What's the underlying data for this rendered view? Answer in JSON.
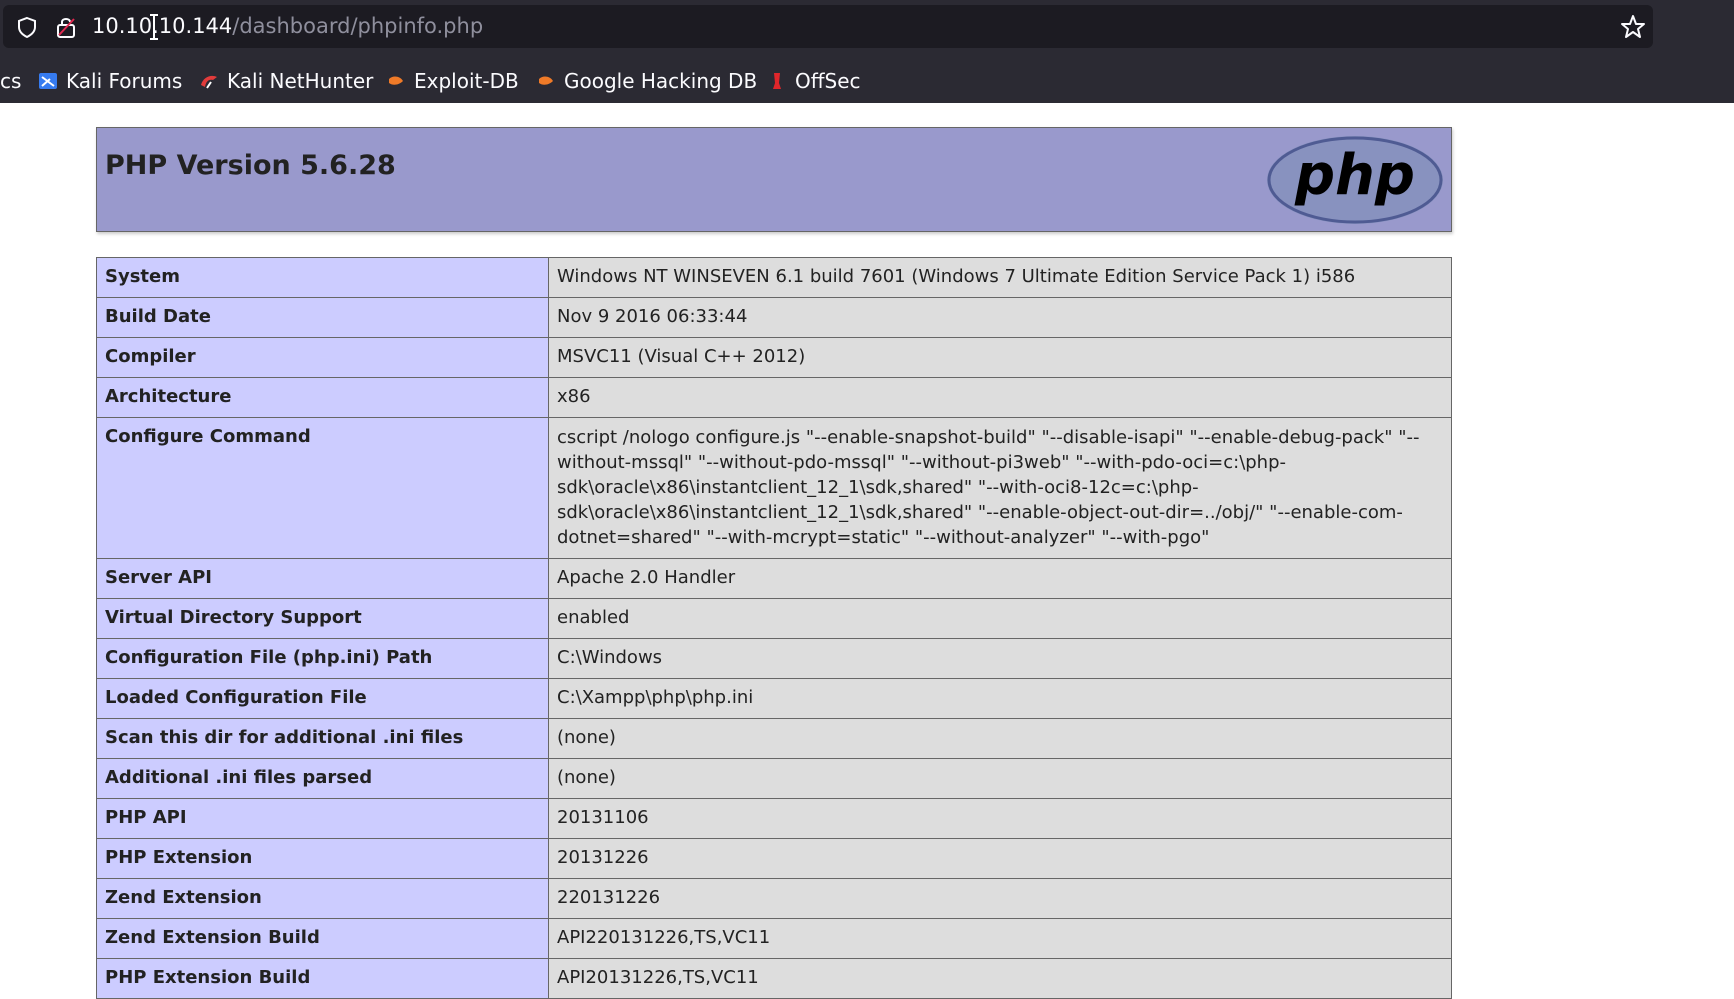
{
  "browser": {
    "url_host": "10.10.10.144",
    "url_path": "/dashboard/phpinfo.php",
    "bookmarks": [
      {
        "label": "cs",
        "icon": "folder-icon"
      },
      {
        "label": "Kali Forums",
        "icon": "kali-forums-icon"
      },
      {
        "label": "Kali NetHunter",
        "icon": "kali-nethunter-icon"
      },
      {
        "label": "Exploit-DB",
        "icon": "exploit-db-icon"
      },
      {
        "label": "Google Hacking DB",
        "icon": "google-hacking-db-icon"
      },
      {
        "label": "OffSec",
        "icon": "offsec-icon"
      }
    ]
  },
  "page": {
    "title": "PHP Version 5.6.28",
    "logo_text": "php",
    "rows": [
      {
        "key": "System",
        "value": "Windows NT WINSEVEN 6.1 build 7601 (Windows 7 Ultimate Edition Service Pack 1) i586"
      },
      {
        "key": "Build Date",
        "value": "Nov 9 2016 06:33:44"
      },
      {
        "key": "Compiler",
        "value": "MSVC11 (Visual C++ 2012)"
      },
      {
        "key": "Architecture",
        "value": "x86"
      },
      {
        "key": "Configure Command",
        "value": "cscript /nologo configure.js \"--enable-snapshot-build\" \"--disable-isapi\" \"--enable-debug-pack\" \"--without-mssql\" \"--without-pdo-mssql\" \"--without-pi3web\" \"--with-pdo-oci=c:\\php-sdk\\oracle\\x86\\instantclient_12_1\\sdk,shared\" \"--with-oci8-12c=c:\\php-sdk\\oracle\\x86\\instantclient_12_1\\sdk,shared\" \"--enable-object-out-dir=../obj/\" \"--enable-com-dotnet=shared\" \"--with-mcrypt=static\" \"--without-analyzer\" \"--with-pgo\""
      },
      {
        "key": "Server API",
        "value": "Apache 2.0 Handler"
      },
      {
        "key": "Virtual Directory Support",
        "value": "enabled"
      },
      {
        "key": "Configuration File (php.ini) Path",
        "value": "C:\\Windows"
      },
      {
        "key": "Loaded Configuration File",
        "value": "C:\\Xampp\\php\\php.ini"
      },
      {
        "key": "Scan this dir for additional .ini files",
        "value": "(none)"
      },
      {
        "key": "Additional .ini files parsed",
        "value": "(none)"
      },
      {
        "key": "PHP API",
        "value": "20131106"
      },
      {
        "key": "PHP Extension",
        "value": "20131226"
      },
      {
        "key": "Zend Extension",
        "value": "220131226"
      },
      {
        "key": "Zend Extension Build",
        "value": "API220131226,TS,VC11"
      },
      {
        "key": "PHP Extension Build",
        "value": "API20131226,TS,VC11"
      }
    ]
  },
  "colors": {
    "chrome_bg": "#2b2a33",
    "urlbar_bg": "#1c1b22",
    "header_bg": "#9999cc",
    "key_cell_bg": "#ccccff",
    "value_cell_bg": "#dddddd"
  }
}
